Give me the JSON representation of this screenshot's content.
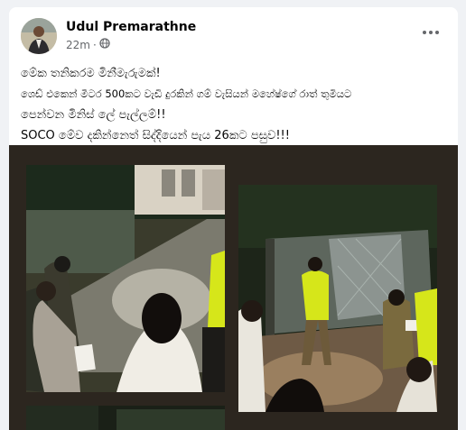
{
  "post": {
    "author": "Udul Premarathne",
    "time": "22m",
    "audience_icon": "globe-icon",
    "more_icon": "more-options-icon",
    "lines": [
      "මේක තනිකරම මිනීමැරුමක්!",
      "ශෙඩ් එකෙන් මීටර 500කට වැඩි දුරකින් ගම් වැසියන් මහේෂ්ගේ රාත් තුමියට",
      "පෙන්වන මිනිස් ලේ පැල්ලම්!!",
      "SOCO මේව දකින්නෙත් සිද්දියෙන් පැය 26කට පසුව!!!"
    ]
  },
  "photos": [
    {
      "name": "photo-crime-scene-path"
    },
    {
      "name": "photo-police-at-gate"
    },
    {
      "name": "photo-bottom-left"
    },
    {
      "name": "photo-bottom-right"
    }
  ],
  "colors": {
    "page_bg": "#f0f2f5",
    "card_bg": "#ffffff",
    "media_bg": "#2c261f",
    "text": "#050505",
    "meta": "#65676b",
    "vest": "#d6e61a"
  }
}
